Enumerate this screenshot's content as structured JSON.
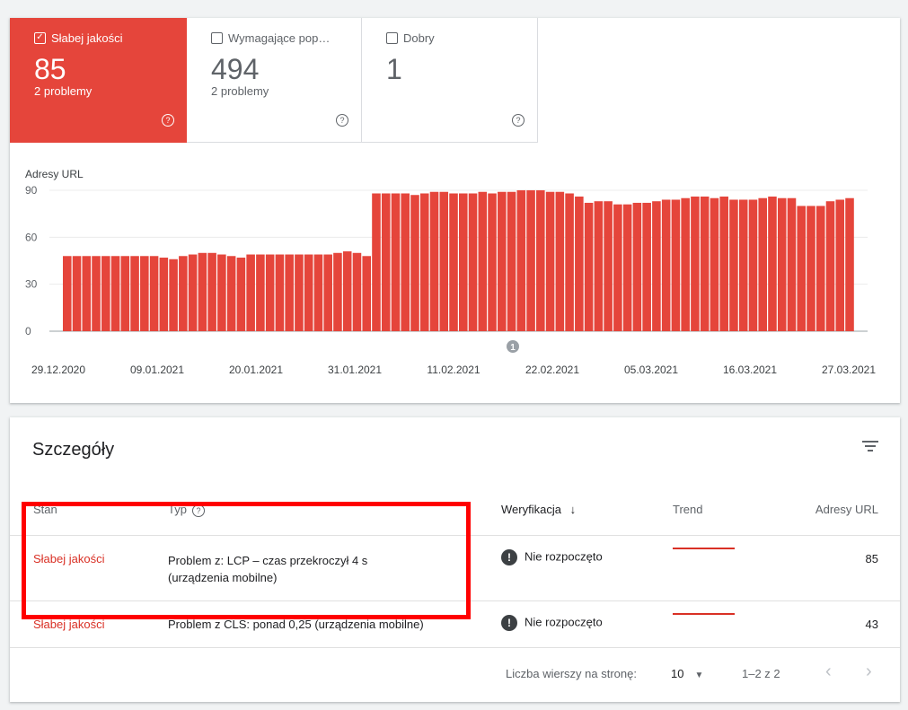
{
  "tiles": [
    {
      "label": "Słabej jakości",
      "check": "✓",
      "count": "85",
      "sub": "2 problemy",
      "help": "?"
    },
    {
      "label": "Wymagające pop…",
      "check": "",
      "count": "494",
      "sub": "2 problemy",
      "help": "?"
    },
    {
      "label": "Dobry",
      "check": "",
      "count": "1",
      "sub": "",
      "help": "?"
    }
  ],
  "chart_data": {
    "type": "bar",
    "title": "",
    "ylabel": "Adresy URL",
    "xlabel": "",
    "ylim": [
      0,
      90
    ],
    "yticks": [
      0,
      30,
      60,
      90
    ],
    "x_tick_labels": [
      "29.12.2020",
      "09.01.2021",
      "20.01.2021",
      "31.01.2021",
      "11.02.2021",
      "22.02.2021",
      "05.03.2021",
      "16.03.2021",
      "27.03.2021"
    ],
    "annotation": "1",
    "color": "#e5453b",
    "values": [
      48,
      48,
      48,
      48,
      48,
      48,
      48,
      48,
      48,
      48,
      47,
      46,
      48,
      49,
      50,
      50,
      49,
      48,
      47,
      49,
      49,
      49,
      49,
      49,
      49,
      49,
      49,
      49,
      50,
      51,
      50,
      48,
      88,
      88,
      88,
      88,
      87,
      88,
      89,
      89,
      88,
      88,
      88,
      89,
      88,
      89,
      89,
      90,
      90,
      90,
      89,
      89,
      88,
      86,
      82,
      83,
      83,
      81,
      81,
      82,
      82,
      83,
      84,
      84,
      85,
      86,
      86,
      85,
      86,
      84,
      84,
      84,
      85,
      86,
      85,
      85,
      80,
      80,
      80,
      83,
      84,
      85
    ]
  },
  "details": {
    "title": "Szczegóły",
    "columns": {
      "status": "Stan",
      "type": "Typ",
      "verification": "Weryfikacja",
      "trend": "Trend",
      "urls": "Adresy URL"
    },
    "sort_arrow": "↓",
    "help": "?",
    "rows": [
      {
        "status": "Słabej jakości",
        "type_line1": "Problem z: LCP – czas przekroczył 4 s",
        "type_line2": "(urządzenia mobilne)",
        "verification": "Nie rozpoczęto",
        "verif_icon": "!",
        "urls": "85"
      },
      {
        "status": "Słabej jakości",
        "type_line1": "Problem z CLS: ponad 0,25 (urządzenia mobilne)",
        "type_line2": "",
        "verification": "Nie rozpoczęto",
        "verif_icon": "!",
        "urls": "43"
      }
    ],
    "footer": {
      "rows_per_page_label": "Liczba wierszy na stronę:",
      "rows_per_page_value": "10",
      "dropdown": "▼",
      "range": "1–2 z 2",
      "prev": "‹",
      "next": "›"
    }
  },
  "colors": {
    "poor": "#e5453b",
    "status_text": "#d93025",
    "highlight": "#ff0000"
  }
}
